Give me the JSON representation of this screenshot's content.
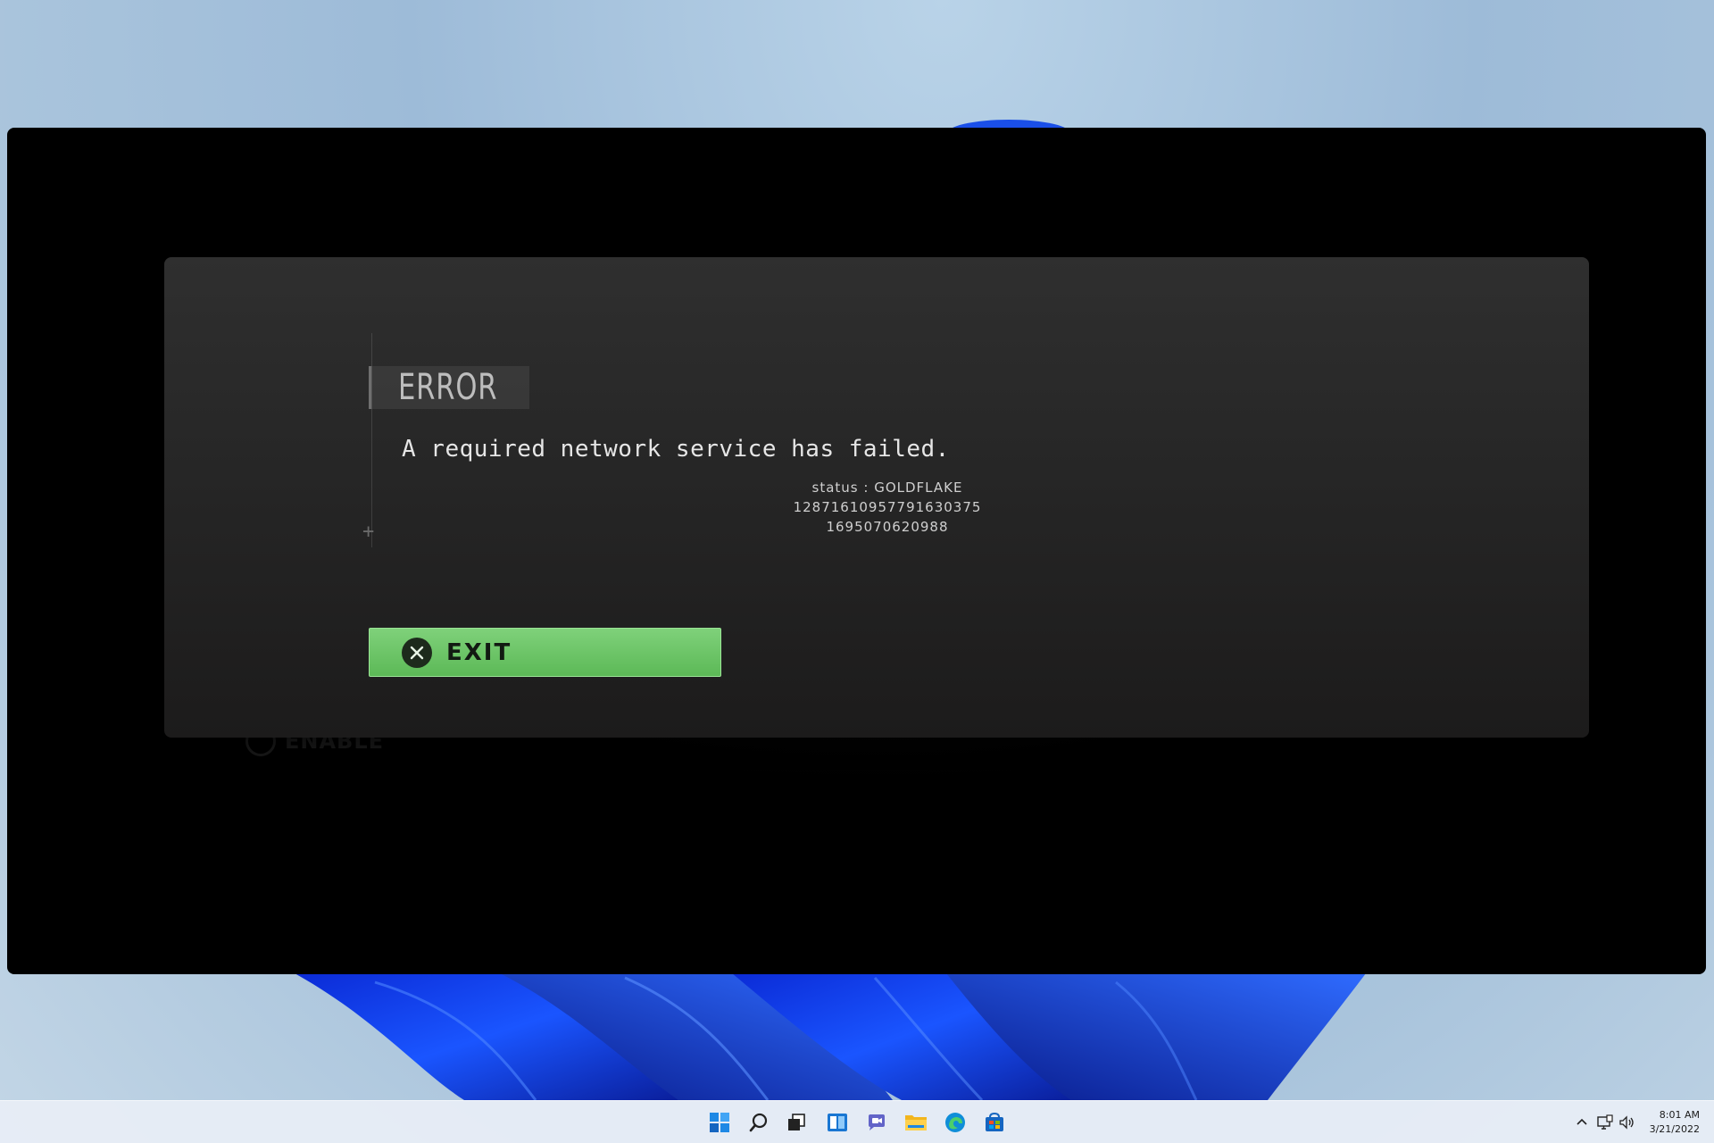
{
  "dialog": {
    "title": "ERROR",
    "message": "A required network service has failed.",
    "status_line": "status : GOLDFLAKE",
    "code_line_1": "12871610957791630375",
    "code_line_2": "1695070620988",
    "exit_label": "EXIT",
    "ghost_label": "ENABLE",
    "guide_marker": "+"
  },
  "colors": {
    "exit_button": "#6cc567",
    "dialog_bg": "#2a2a2a",
    "game_bg": "#000000"
  },
  "taskbar": {
    "icons": [
      {
        "name": "start-icon"
      },
      {
        "name": "search-icon"
      },
      {
        "name": "task-view-icon"
      },
      {
        "name": "widgets-icon"
      },
      {
        "name": "chat-icon"
      },
      {
        "name": "file-explorer-icon"
      },
      {
        "name": "edge-icon"
      },
      {
        "name": "store-icon"
      }
    ],
    "tray": {
      "time": "8:01 AM",
      "date": "3/21/2022"
    }
  }
}
